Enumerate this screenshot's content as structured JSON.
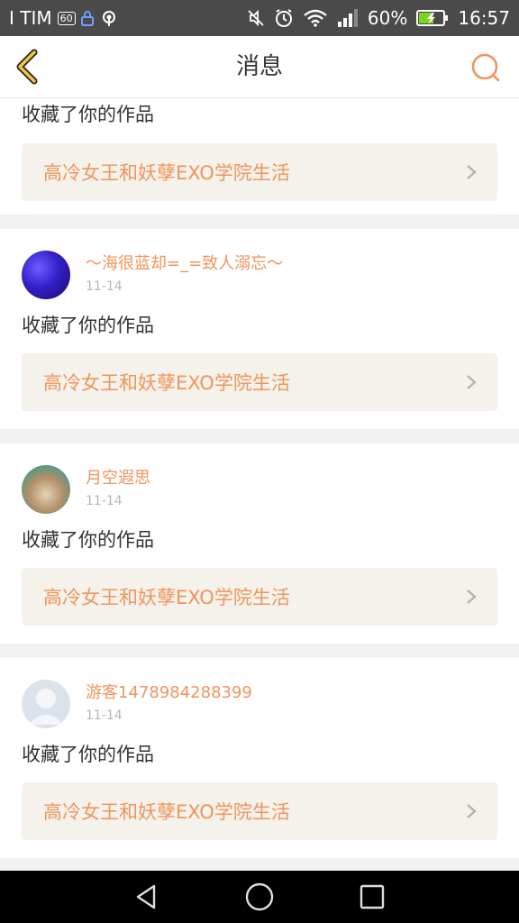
{
  "status_bar": {
    "carrier": "I TIM",
    "battery_percent": "60%",
    "time": "16:57",
    "icons": [
      "hd-icon",
      "lock-icon",
      "hotspot-icon",
      "mute-icon",
      "alarm-icon",
      "wifi-icon",
      "signal-icon",
      "battery-icon"
    ],
    "hd_label": "60"
  },
  "header": {
    "title": "消息",
    "accent_color": "#f5c542",
    "icons": [
      "back-icon",
      "search-icon"
    ]
  },
  "messages": [
    {
      "action": "收藏了你的作品",
      "work_title": "高冷女王和妖孽EXO学院生活"
    },
    {
      "username": "～海很蓝却=_=致人溺忘～",
      "time": "11-14",
      "action": "收藏了你的作品",
      "work_title": "高冷女王和妖孽EXO学院生活"
    },
    {
      "username": "月空遐思",
      "time": "11-14",
      "action": "收藏了你的作品",
      "work_title": "高冷女王和妖孽EXO学院生活"
    },
    {
      "username": "游客1478984288399",
      "time": "11-14",
      "action": "收藏了你的作品",
      "work_title": "高冷女王和妖孽EXO学院生活"
    }
  ],
  "nav_bar": {
    "icons": [
      "back-triangle-icon",
      "home-circle-icon",
      "recents-square-icon"
    ]
  },
  "colors": {
    "username": "#f0955c",
    "link_bg": "#f4f2ea",
    "timestamp": "#b5b5b5"
  }
}
